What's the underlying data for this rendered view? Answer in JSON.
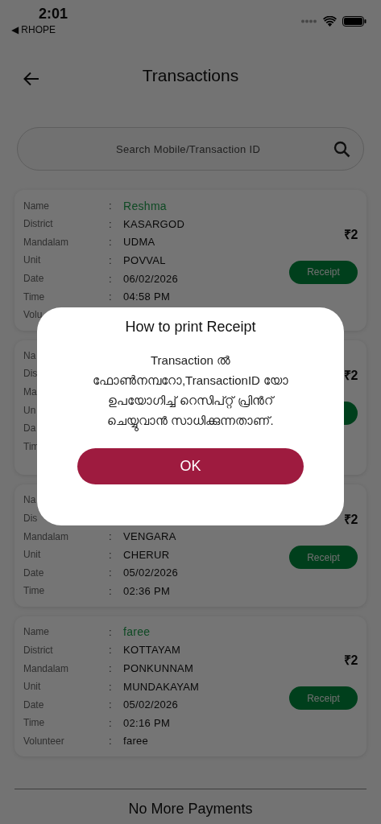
{
  "status_bar": {
    "time": "2:01",
    "back_app": "◀ RHOPE"
  },
  "header": {
    "title": "Transactions"
  },
  "search": {
    "placeholder": "Search Mobile/Transaction ID"
  },
  "transactions": [
    {
      "rows": [
        {
          "kind": "name",
          "label": "Name",
          "colon": ":",
          "value": "Reshma"
        },
        {
          "kind": "field",
          "label": "District",
          "colon": ":",
          "value": "KASARGOD"
        },
        {
          "kind": "field",
          "label": "Mandalam",
          "colon": ":",
          "value": "UDMA"
        },
        {
          "kind": "field",
          "label": "Unit",
          "colon": ":",
          "value": "POVVAL"
        },
        {
          "kind": "field",
          "label": "Date",
          "colon": ":",
          "value": "06/02/2026"
        },
        {
          "kind": "field",
          "label": "Time",
          "colon": ":",
          "value": "04:58 PM"
        },
        {
          "kind": "field",
          "label": "Volu"
        }
      ],
      "amount": "₹2",
      "receipt_button": true,
      "receipt": "Receipt"
    },
    {
      "rows": [
        {
          "kind": "field",
          "label": "Na"
        },
        {
          "kind": "field",
          "label": "Dis"
        },
        {
          "kind": "field",
          "label": "Ma"
        },
        {
          "kind": "field",
          "label": "Un"
        },
        {
          "kind": "field",
          "label": "Da"
        },
        {
          "kind": "field",
          "label": "Tim"
        }
      ],
      "amount": "₹2",
      "receipt_button": true
    },
    {
      "rows": [
        {
          "kind": "field",
          "label": "Na"
        },
        {
          "kind": "field",
          "label": "Dis"
        },
        {
          "kind": "field",
          "label": "Mandalam",
          "colon": ":",
          "value": "VENGARA"
        },
        {
          "kind": "field",
          "label": "Unit",
          "colon": ":",
          "value": "CHERUR"
        },
        {
          "kind": "field",
          "label": "Date",
          "colon": ":",
          "value": "05/02/2026"
        },
        {
          "kind": "field",
          "label": "Time",
          "colon": ":",
          "value": "02:36 PM"
        }
      ],
      "amount": "₹2",
      "receipt_button": true,
      "receipt": "Receipt"
    },
    {
      "rows": [
        {
          "kind": "name",
          "label": "Name",
          "colon": ":",
          "value": "faree"
        },
        {
          "kind": "field",
          "label": "District",
          "colon": ":",
          "value": "KOTTAYAM"
        },
        {
          "kind": "field",
          "label": "Mandalam",
          "colon": ":",
          "value": "PONKUNNAM"
        },
        {
          "kind": "field",
          "label": "Unit",
          "colon": ":",
          "value": "MUNDAKAYAM"
        },
        {
          "kind": "field",
          "label": "Date",
          "colon": ":",
          "value": "05/02/2026"
        },
        {
          "kind": "field",
          "label": "Time",
          "colon": ":",
          "value": "02:16 PM"
        },
        {
          "kind": "field",
          "label": "Volunteer",
          "colon": ":",
          "value": "faree"
        }
      ],
      "amount": "₹2",
      "receipt_button": true,
      "receipt": "Receipt"
    }
  ],
  "footer": {
    "message": "No More Payments"
  },
  "dialog": {
    "title": "How to print Receipt",
    "message": "Transaction ൽ ഫോൺനമ്പറോ,TransactionID യോ ഉപയോഗിച്ച് റെസിപ്റ്റ് പ്രിൻറ് ചെയ്യുവാൻ സാധിക്കുന്നതാണ്.",
    "button": "OK"
  }
}
